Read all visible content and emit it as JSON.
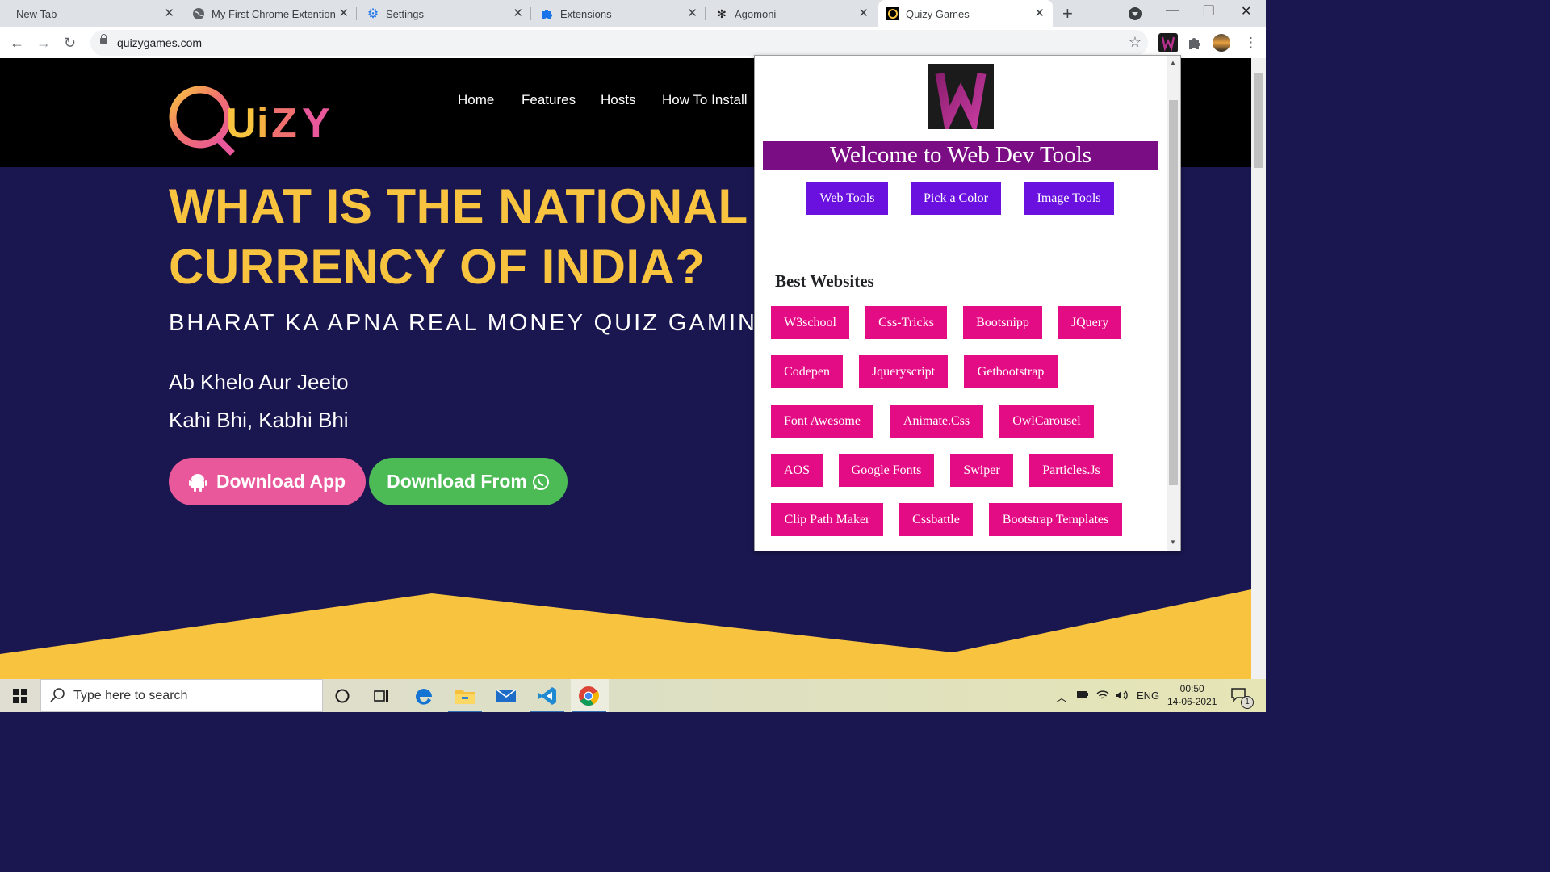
{
  "browser": {
    "tabs": [
      {
        "title": "New Tab",
        "icon": "blank-icon"
      },
      {
        "title": "My First Chrome Extention",
        "icon": "globe-icon"
      },
      {
        "title": "Settings",
        "icon": "gear-icon"
      },
      {
        "title": "Extensions",
        "icon": "puzzle-icon"
      },
      {
        "title": "Agomoni",
        "icon": "agomoni-icon"
      },
      {
        "title": "Quizy Games",
        "icon": "quizy-favicon",
        "active": true
      }
    ],
    "url": "quizygames.com"
  },
  "site": {
    "logo_text": "QUiZY",
    "nav": [
      "Home",
      "Features",
      "Hosts",
      "How To Install"
    ],
    "headline_line1": "WHAT IS THE NATIONAL",
    "headline_line2": "CURRENCY OF INDIA?",
    "subhead": "BHARAT KA APNA REAL MONEY QUIZ GAMING",
    "tagline1": "Ab Khelo Aur Jeeto",
    "tagline2": "Kahi Bhi, Kabhi Bhi",
    "btn_app": "Download App",
    "btn_whatsapp": "Download From",
    "colors": {
      "headline": "#f8c440",
      "bg": "#1a1650",
      "app_btn": "#e8589a",
      "wa_btn": "#4cbb56",
      "wave": "#f8c440"
    }
  },
  "popup": {
    "title": "Welcome to Web Dev Tools",
    "tools": [
      "Web Tools",
      "Pick a Color",
      "Image Tools"
    ],
    "best_heading": "Best Websites",
    "sites": [
      [
        "W3school",
        "Css-Tricks",
        "Bootsnipp",
        "JQuery"
      ],
      [
        "Codepen",
        "Jqueryscript",
        "Getbootstrap"
      ],
      [
        "Font Awesome",
        "Animate.Css",
        "OwlCarousel"
      ],
      [
        "AOS",
        "Google Fonts",
        "Swiper",
        "Particles.Js"
      ],
      [
        "Clip Path Maker",
        "Cssbattle",
        "Bootstrap Templates"
      ]
    ],
    "colors": {
      "title_bg": "#7a0d84",
      "tool_btn": "#6a11df",
      "site_btn": "#e30c84"
    }
  },
  "taskbar": {
    "search_placeholder": "Type here to search",
    "lang": "ENG",
    "time": "00:50",
    "date": "14-06-2021",
    "notifications": "1"
  }
}
